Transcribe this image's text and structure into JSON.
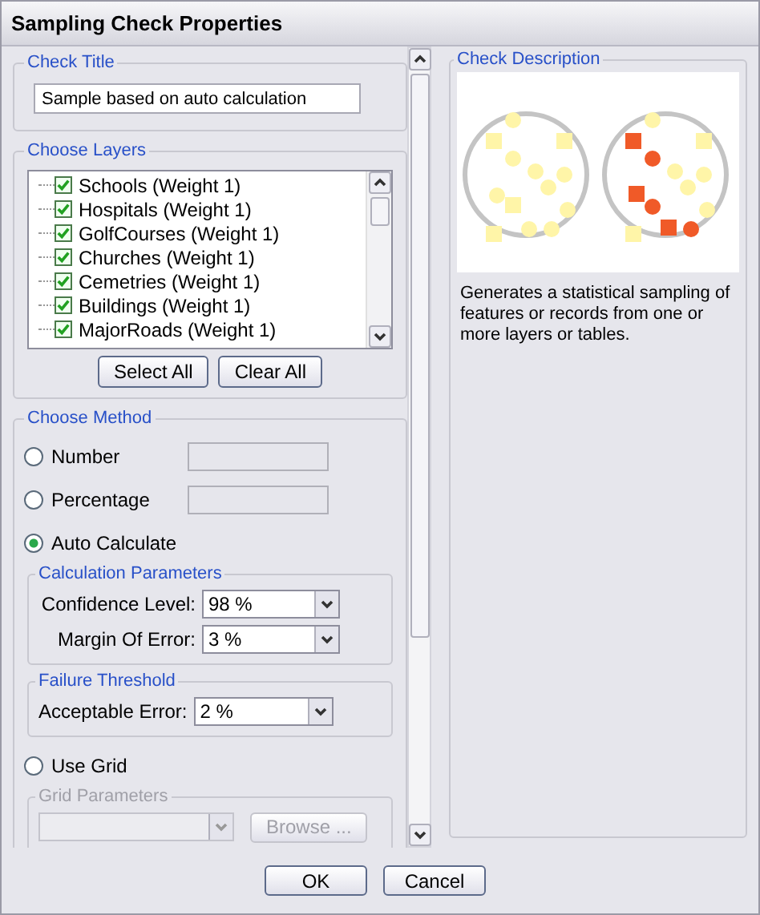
{
  "window": {
    "title": "Sampling Check Properties"
  },
  "check_title": {
    "label": "Check Title",
    "value": "Sample based on auto calculation"
  },
  "layers": {
    "label": "Choose Layers",
    "items": [
      {
        "name": "Schools (Weight 1)",
        "checked": true
      },
      {
        "name": "Hospitals (Weight 1)",
        "checked": true
      },
      {
        "name": "GolfCourses (Weight 1)",
        "checked": true
      },
      {
        "name": "Churches (Weight 1)",
        "checked": true
      },
      {
        "name": "Cemetries (Weight 1)",
        "checked": true
      },
      {
        "name": "Buildings (Weight 1)",
        "checked": true
      },
      {
        "name": "MajorRoads (Weight 1)",
        "checked": true
      }
    ],
    "buttons": [
      "Select All",
      "Clear All"
    ]
  },
  "method": {
    "label": "Choose Method",
    "options": [
      {
        "label": "Number",
        "selected": false,
        "kind": "field"
      },
      {
        "label": "Percentage",
        "selected": false,
        "kind": "field"
      },
      {
        "label": "Auto Calculate",
        "selected": true,
        "kind": "auto"
      },
      {
        "label": "Use Grid",
        "selected": false,
        "kind": "grid"
      }
    ],
    "calculation": {
      "label": "Calculation Parameters",
      "fields": [
        {
          "label": "Confidence Level:",
          "value": "98 %"
        },
        {
          "label": "Margin Of Error:",
          "value": "3 %"
        }
      ]
    },
    "failure": {
      "label": "Failure Threshold",
      "fields": [
        {
          "label": "Acceptable Error:",
          "value": "2 %"
        }
      ]
    },
    "grid": {
      "label": "Grid Parameters",
      "disabled": true,
      "browse": "Browse ..."
    }
  },
  "description": {
    "label": "Check Description",
    "text": "Generates a statistical sampling of features or records from one or more layers or tables."
  },
  "buttons": [
    "OK",
    "Cancel"
  ]
}
